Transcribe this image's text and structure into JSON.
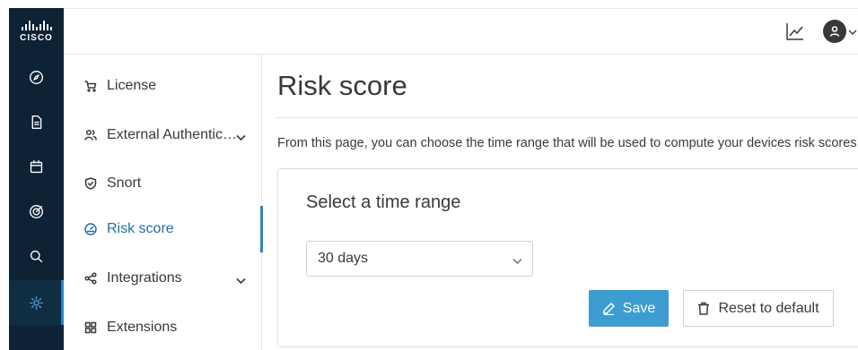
{
  "brand": {
    "logo_text": "CISCO"
  },
  "rail": {
    "items": [
      {
        "icon": "compass-icon"
      },
      {
        "icon": "document-icon"
      },
      {
        "icon": "calendar-icon"
      },
      {
        "icon": "target-icon"
      },
      {
        "icon": "search-icon"
      },
      {
        "icon": "gear-icon",
        "active": true
      }
    ]
  },
  "topbar": {
    "chart_icon": "chart-icon",
    "user_icon": "user-icon"
  },
  "subnav": {
    "items": [
      {
        "label": "License",
        "icon": "cart-icon"
      },
      {
        "label": "External Authentic…",
        "icon": "users-icon",
        "expandable": true
      },
      {
        "label": "Snort",
        "icon": "shield-icon"
      },
      {
        "label": "Risk score",
        "icon": "gauge-icon",
        "active": true
      },
      {
        "label": "Integrations",
        "icon": "share-icon",
        "expandable": true
      },
      {
        "label": "Extensions",
        "icon": "grid-icon"
      }
    ]
  },
  "main": {
    "title": "Risk score",
    "description": "From this page, you can choose the time range that will be used to compute your devices risk scores",
    "card": {
      "title": "Select a time range",
      "select_value": "30 days",
      "save_label": "Save",
      "reset_label": "Reset to default"
    }
  },
  "colors": {
    "rail_bg": "#0d2234",
    "accent": "#3d9dd1",
    "active_text": "#1f6fa3"
  }
}
